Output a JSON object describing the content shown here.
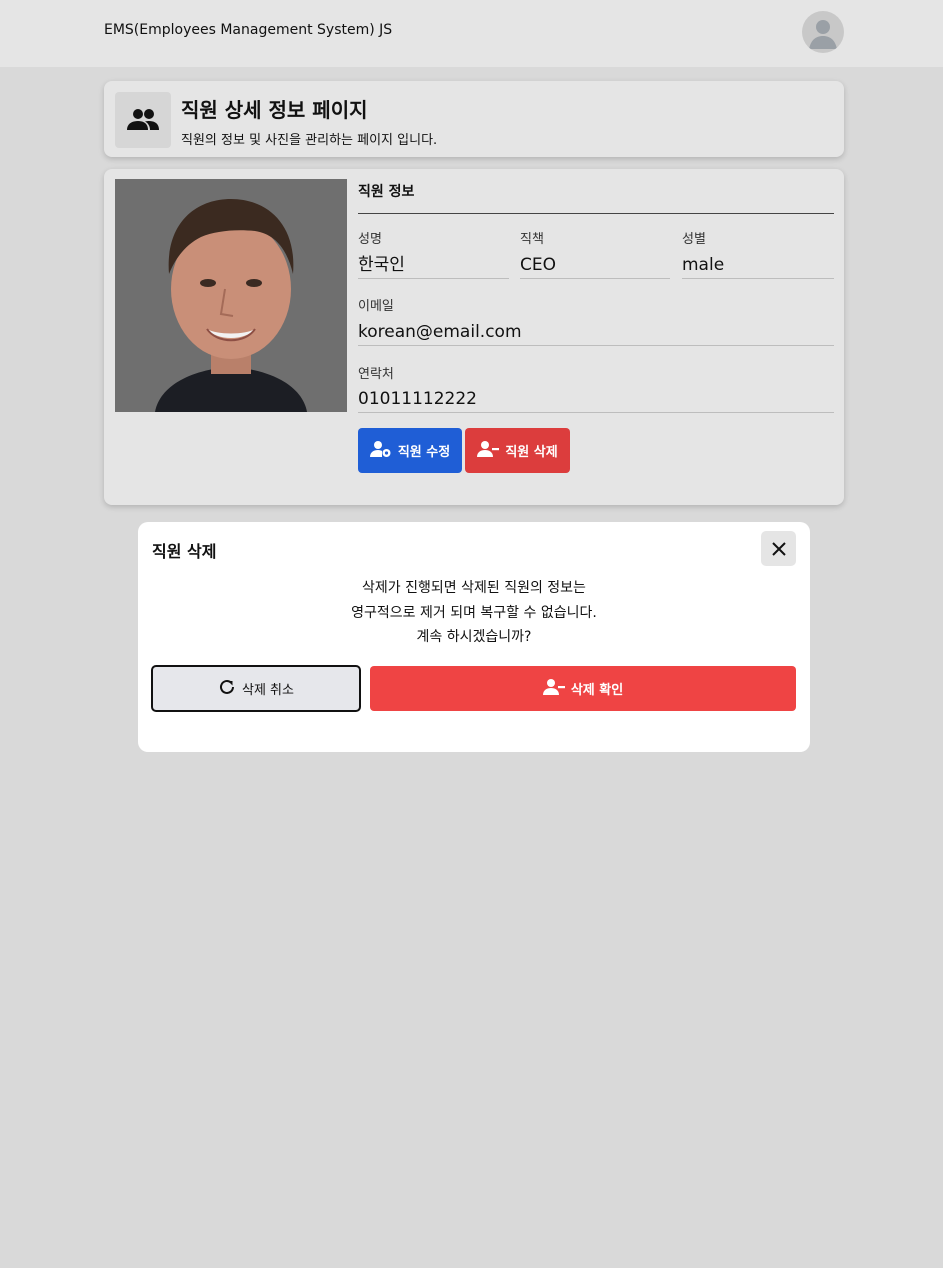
{
  "header": {
    "app_title": "EMS(Employees Management System) JS",
    "avatar_icon": "user-avatar-icon"
  },
  "page": {
    "title": "직원 상세 정보 페이지",
    "subtitle": "직원의 정보 및 사진을 관리하는 페이지 입니다.",
    "icon": "people-icon"
  },
  "employee": {
    "section_title": "직원 정보",
    "fields": {
      "name": {
        "label": "성명",
        "value": "한국인"
      },
      "position": {
        "label": "직책",
        "value": "CEO"
      },
      "gender": {
        "label": "성별",
        "value": "male"
      },
      "email": {
        "label": "이메일",
        "value": "korean@email.com"
      },
      "phone": {
        "label": "연락처",
        "value": "01011112222"
      }
    },
    "edit_button": "직원 수정",
    "delete_button": "직원 삭제"
  },
  "modal": {
    "title": "직원 삭제",
    "message_lines": [
      "삭제가 진행되면 삭제된 직원의 정보는",
      "영구적으로 제거 되며 복구할 수 없습니다.",
      "계속 하시겠습니까?"
    ],
    "cancel_label": "삭제 취소",
    "confirm_label": "삭제 확인"
  },
  "colors": {
    "edit_button": "#1f5ed6",
    "delete_button": "#dc3d3d",
    "confirm_button": "#ef4444",
    "page_background": "#d9d9d9"
  }
}
